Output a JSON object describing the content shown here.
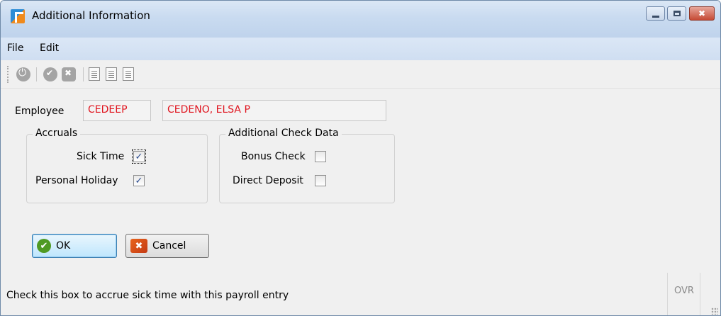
{
  "window": {
    "title": "Additional Information",
    "app_icon": "app-logo-icon",
    "controls": {
      "minimize": "minimize-icon",
      "maximize": "maximize-icon",
      "close": "close-icon",
      "close_glyph": "✖"
    }
  },
  "menu": {
    "items": [
      "File",
      "Edit"
    ]
  },
  "toolbar": {
    "icons": [
      "power-icon",
      "check-icon",
      "cancel-icon",
      "doc-icon",
      "copy-doc-icon",
      "select-doc-icon"
    ]
  },
  "employee": {
    "label": "Employee",
    "id": "CEDEEP",
    "name": "CEDENO, ELSA P"
  },
  "accruals": {
    "title": "Accruals",
    "sick_time": {
      "label": "Sick Time",
      "checked": true,
      "mark": "✓"
    },
    "personal_holiday": {
      "label": "Personal Holiday",
      "checked": true,
      "mark": "✓"
    }
  },
  "check_data": {
    "title": "Additional Check Data",
    "bonus_check": {
      "label": "Bonus Check",
      "checked": false,
      "mark": ""
    },
    "direct_deposit": {
      "label": "Direct Deposit",
      "checked": false,
      "mark": ""
    }
  },
  "buttons": {
    "ok": {
      "label": "OK",
      "icon_glyph": "✔"
    },
    "cancel": {
      "label": "Cancel",
      "icon_glyph": "✖"
    }
  },
  "status": {
    "message": "Check this box to accrue sick time with this payroll entry",
    "mode": "OVR"
  },
  "colors": {
    "field_text": "#e0141e",
    "titlebar": "#c9dbf0",
    "ok_icon": "#4f9a23",
    "cancel_icon": "#d24a1a"
  }
}
